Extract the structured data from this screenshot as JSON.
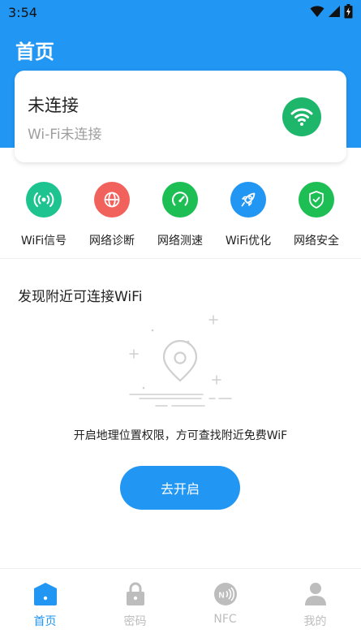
{
  "status_bar": {
    "time": "3:54"
  },
  "header": {
    "title": "首页"
  },
  "connection": {
    "title": "未连接",
    "subtitle": "Wi-Fi未连接",
    "icon": "wifi-icon"
  },
  "features": [
    {
      "label": "WiFi信号",
      "icon": "wifi-signal-icon",
      "color": "#1ec48f"
    },
    {
      "label": "网络诊断",
      "icon": "globe-icon",
      "color": "#f2625c"
    },
    {
      "label": "网络测速",
      "icon": "speedometer-icon",
      "color": "#1dbf55"
    },
    {
      "label": "WiFi优化",
      "icon": "rocket-icon",
      "color": "#2196f3"
    },
    {
      "label": "网络安全",
      "icon": "shield-icon",
      "color": "#1dbf55"
    }
  ],
  "nearby": {
    "title": "发现附近可连接WiFi",
    "message": "开启地理位置权限，方可查找附近免费WiF",
    "button_label": "去开启"
  },
  "bottom_nav": [
    {
      "label": "首页",
      "icon": "home-icon",
      "active": true
    },
    {
      "label": "密码",
      "icon": "lock-icon",
      "active": false
    },
    {
      "label": "NFC",
      "icon": "nfc-icon",
      "active": false
    },
    {
      "label": "我的",
      "icon": "person-icon",
      "active": false
    }
  ],
  "colors": {
    "primary": "#2196f3",
    "inactive": "#bdbdbd",
    "wifi_badge": "#1db66b"
  }
}
